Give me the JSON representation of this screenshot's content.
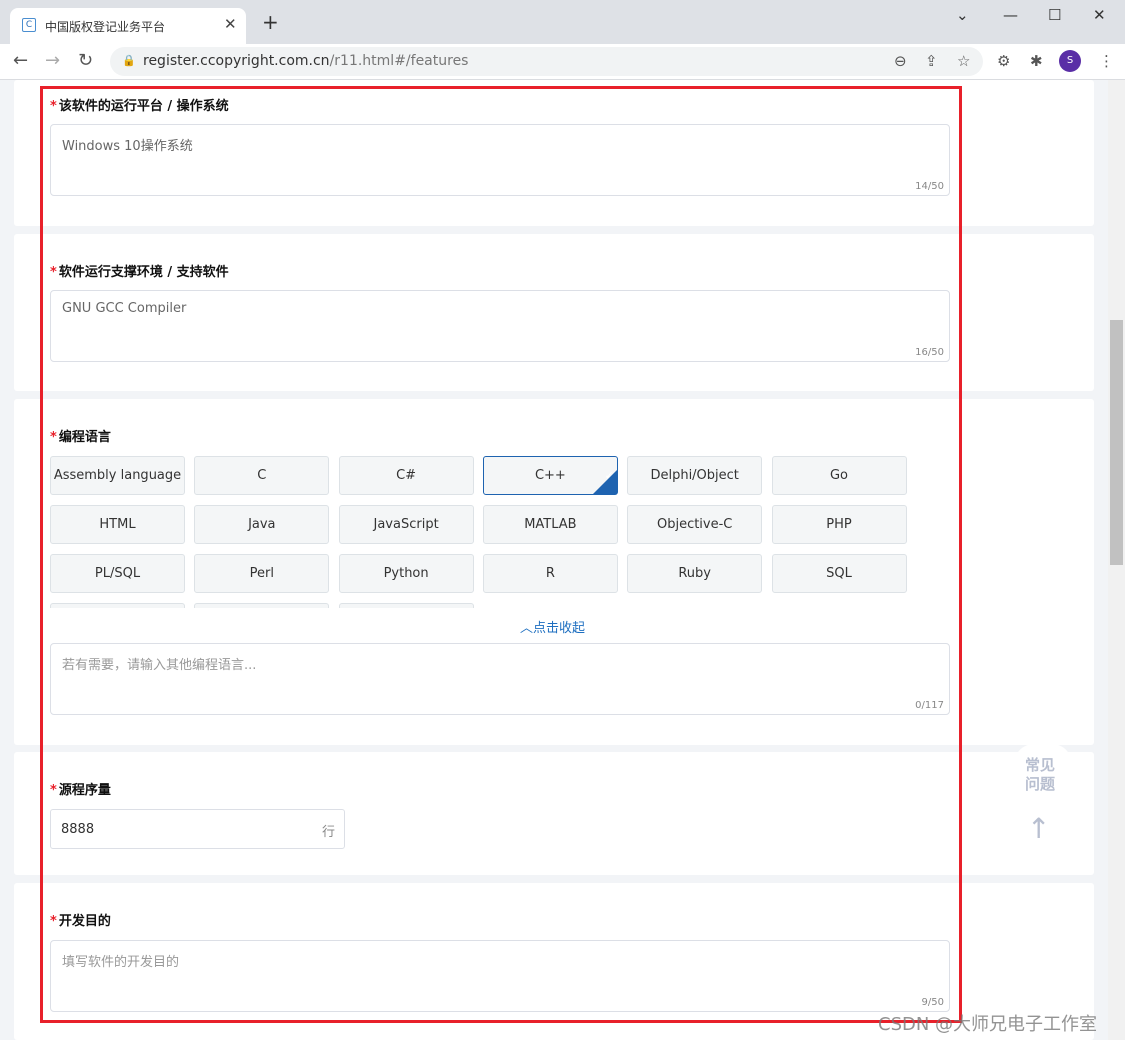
{
  "browser": {
    "tab_title": "中国版权登记业务平台",
    "favicon": "C",
    "url_host": "register.ccopyright.com.cn",
    "url_path": "/r11.html#/features",
    "profile_initial": "S",
    "icons": [
      "back-icon",
      "forward-icon",
      "reload-icon",
      "lock-icon",
      "zoom-out-icon",
      "share-icon",
      "star-icon",
      "extension-icon",
      "puzzle-icon",
      "more-icon"
    ]
  },
  "form": {
    "platform": {
      "label": "该软件的运行平台 / 操作系统",
      "value": "Windows 10操作系统",
      "count": "14/50"
    },
    "environment": {
      "label": "软件运行支撑环境 / 支持软件",
      "value": "GNU GCC Compiler",
      "count": "16/50"
    },
    "languages": {
      "label": "编程语言",
      "options": [
        "Assembly language",
        "C",
        "C#",
        "C++",
        "Delphi/Object Pascal",
        "Go",
        "HTML",
        "Java",
        "JavaScript",
        "MATLAB",
        "Objective-C",
        "PHP",
        "PL/SQL",
        "Perl",
        "Python",
        "R",
        "Ruby",
        "SQL",
        "",
        "",
        ""
      ],
      "selected": "C++",
      "collapse_label": "点击收起",
      "other_placeholder": "若有需要，请输入其他编程语言...",
      "other_count": "0/117"
    },
    "source_lines": {
      "label": "源程序量",
      "value": "8888",
      "unit": "行"
    },
    "purpose": {
      "label": "开发目的",
      "placeholder": "填写软件的开发目的",
      "count": "9/50"
    },
    "required_mark": "*"
  },
  "faq": {
    "label": "常见问题"
  },
  "watermark": "CSDN @大师兄电子工作室",
  "colors": {
    "accent": "#1e63b0",
    "required": "#e8202a",
    "annotation": "#e8202a"
  }
}
